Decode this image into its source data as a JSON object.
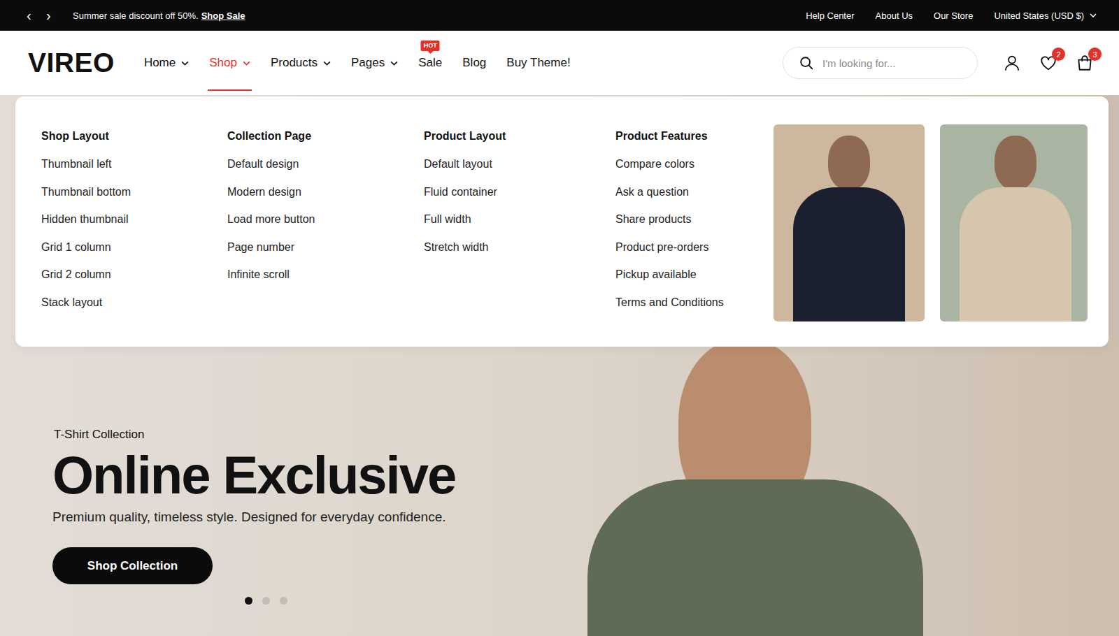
{
  "announcement": {
    "prev": "‹",
    "next": "›",
    "text": "Summer sale discount off 50%.",
    "link": "Shop Sale"
  },
  "top_links": [
    "Help Center",
    "About Us",
    "Our Store"
  ],
  "currency": {
    "label": "United States (USD $)"
  },
  "logo": "VIREO",
  "nav": [
    {
      "label": "Home",
      "has_dropdown": true,
      "selected": false,
      "badge": ""
    },
    {
      "label": "Shop",
      "has_dropdown": true,
      "selected": true,
      "badge": ""
    },
    {
      "label": "Products",
      "has_dropdown": true,
      "selected": false,
      "badge": ""
    },
    {
      "label": "Pages",
      "has_dropdown": true,
      "selected": false,
      "badge": ""
    },
    {
      "label": "Sale",
      "has_dropdown": false,
      "selected": false,
      "badge": "HOT"
    },
    {
      "label": "Blog",
      "has_dropdown": false,
      "selected": false,
      "badge": ""
    },
    {
      "label": "Buy Theme!",
      "has_dropdown": false,
      "selected": false,
      "badge": ""
    }
  ],
  "search": {
    "placeholder": "I'm looking for..."
  },
  "wishlist_count": "2",
  "cart_count": "3",
  "mega_menu": {
    "columns": [
      {
        "title": "Shop Layout",
        "items": [
          "Thumbnail left",
          "Thumbnail bottom",
          "Hidden thumbnail",
          "Grid 1 column",
          "Grid 2 column",
          "Stack layout"
        ]
      },
      {
        "title": "Collection Page",
        "items": [
          "Default design",
          "Modern design",
          "Load more button",
          "Page number",
          "Infinite scroll"
        ]
      },
      {
        "title": "Product Layout",
        "items": [
          "Default layout",
          "Fluid container",
          "Full width",
          "Stretch width"
        ]
      },
      {
        "title": "Product Features",
        "items": [
          "Compare colors",
          "Ask a question",
          "Share products",
          "Product pre-orders",
          "Pickup available",
          "Terms and Conditions"
        ]
      }
    ]
  },
  "hero": {
    "eyebrow": "T-Shirt Collection",
    "title": "Online Exclusive",
    "subtitle": "Premium quality, timeless style. Designed for everyday confidence.",
    "button": "Shop Collection",
    "slides": [
      {
        "selected": true
      },
      {
        "selected": false
      },
      {
        "selected": false
      }
    ]
  }
}
